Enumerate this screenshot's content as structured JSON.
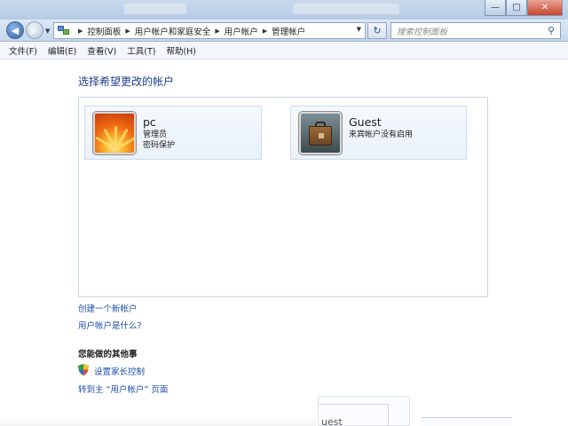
{
  "window": {
    "minimize_glyph": "—",
    "maximize_glyph": "□",
    "close_glyph": "✕"
  },
  "nav": {
    "breadcrumbs": [
      "控制面板",
      "用户帐户和家庭安全",
      "用户帐户",
      "管理帐户"
    ],
    "search_placeholder": "搜索控制面板"
  },
  "menu": [
    "文件(F)",
    "编辑(E)",
    "查看(V)",
    "工具(T)",
    "帮助(H)"
  ],
  "main": {
    "heading": "选择希望更改的帐户",
    "accounts": [
      {
        "name": "pc",
        "role": "管理员",
        "status": "密码保护",
        "picture": "flower-icon"
      },
      {
        "name": "Guest",
        "role": "",
        "status": "来宾帐户没有启用",
        "picture": "briefcase-icon"
      }
    ],
    "create_link": "创建一个新帐户",
    "what_link": "用户帐户是什么?",
    "other_heading": "您能做的其他事",
    "parental_link": "设置家长控制",
    "goto_link": "转到主 “用户帐户” 页面"
  },
  "background": {
    "peek_text": "uest"
  }
}
